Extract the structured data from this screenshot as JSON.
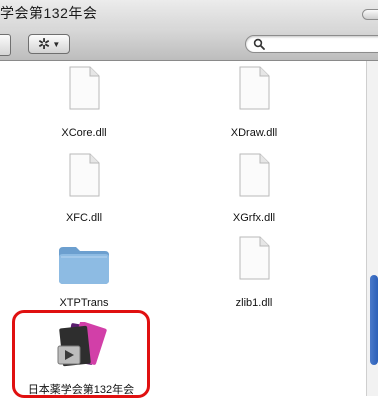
{
  "window": {
    "title": "学会第132年会"
  },
  "toolbar": {
    "action_menu_icon": "gear-icon",
    "search_placeholder": ""
  },
  "files": [
    {
      "name": "XCore.dll",
      "kind": "document"
    },
    {
      "name": "XDraw.dll",
      "kind": "document"
    },
    {
      "name": "XFC.dll",
      "kind": "document"
    },
    {
      "name": "XGrfx.dll",
      "kind": "document"
    },
    {
      "name": "XTPTrans",
      "kind": "folder"
    },
    {
      "name": "zlib1.dll",
      "kind": "document"
    },
    {
      "name": "日本薬学会第132年会",
      "kind": "application"
    }
  ],
  "colors": {
    "highlight": "#e01010",
    "folder": "#7fb0dc",
    "scroll_thumb": "#2b5fb8"
  }
}
